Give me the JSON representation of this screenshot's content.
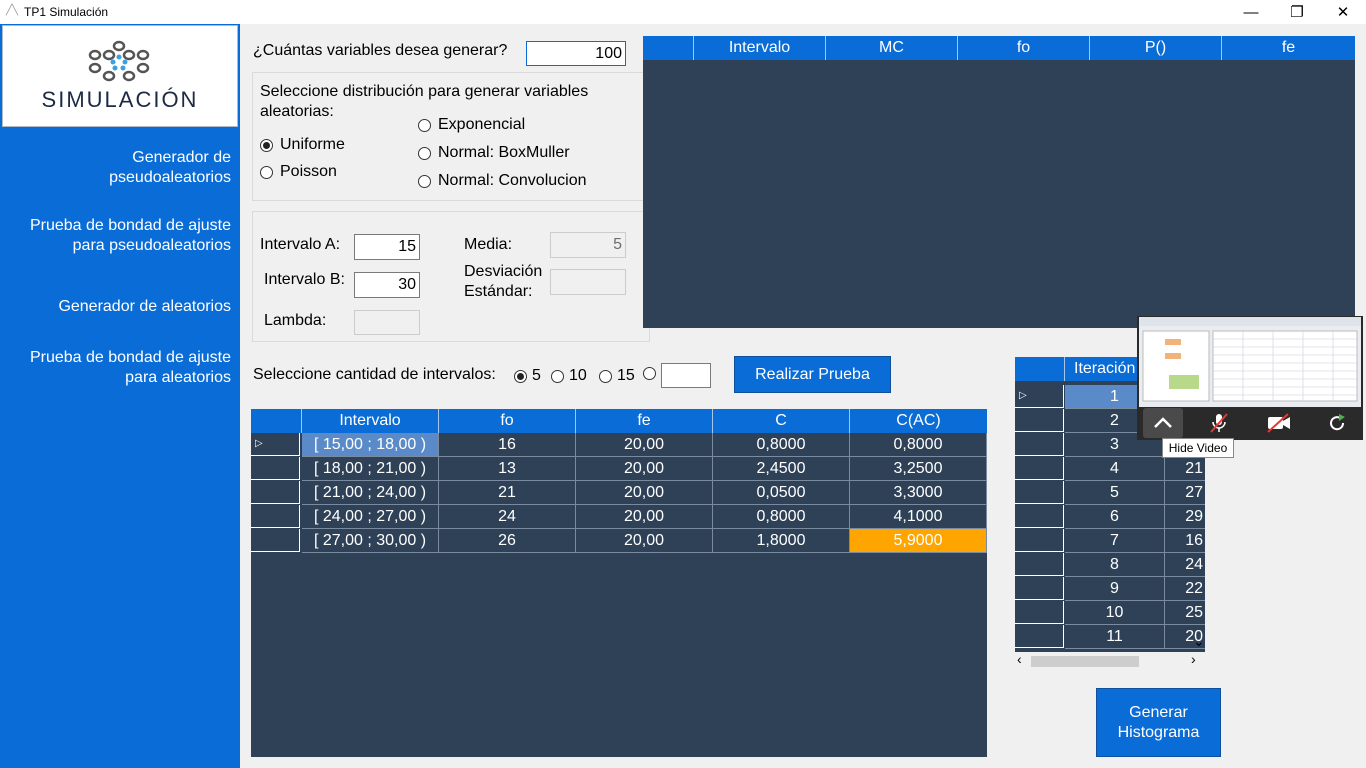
{
  "window": {
    "title": "TP1 Simulación",
    "minimize": "—",
    "restore": "❐",
    "close": "✕"
  },
  "sidebar": {
    "logo_text": "SIMULACIÓN",
    "items": [
      {
        "line1": "Generador de",
        "line2": "pseudoaleatorios"
      },
      {
        "line1": "Prueba de bondad de ajuste",
        "line2": "para pseudoaleatorios"
      },
      {
        "line1": "Generador de aleatorios",
        "line2": ""
      },
      {
        "line1": "Prueba de bondad de ajuste",
        "line2": "para aleatorios"
      }
    ]
  },
  "form": {
    "count_label": "¿Cuántas variables desea generar?",
    "count_value": "100",
    "dist_label": "Seleccione distribución para generar variables aleatorias:",
    "distributions": {
      "uniforme": "Uniforme",
      "poisson": "Poisson",
      "exponencial": "Exponencial",
      "boxmuller": "Normal: BoxMuller",
      "convolucion": "Normal: Convolucion"
    },
    "selected_distribution": "Uniforme",
    "a_label": "Intervalo A:",
    "a_value": "15",
    "b_label": "Intervalo B:",
    "b_value": "30",
    "lambda_label": "Lambda:",
    "lambda_value": "",
    "media_label": "Media:",
    "media_value": "5",
    "desv_label_1": "Desviación",
    "desv_label_2": "Estándar:",
    "desv_value": "",
    "intervals_label": "Seleccione cantidad de intervalos:",
    "interval_options": [
      "5",
      "10",
      "15"
    ],
    "interval_selected": "5",
    "interval_custom": "",
    "test_button": "Realizar Prueba",
    "histogram_button_1": "Generar",
    "histogram_button_2": "Histograma"
  },
  "top_grid": {
    "columns": [
      "Intervalo",
      "MC",
      "fo",
      "P()",
      "fe"
    ]
  },
  "main_grid": {
    "columns": [
      "Intervalo",
      "fo",
      "fe",
      "C",
      "C(AC)"
    ],
    "row_marker": "▷",
    "rows": [
      [
        "[ 15,00 ; 18,00 )",
        "16",
        "20,00",
        "0,8000",
        "0,8000"
      ],
      [
        "[ 18,00 ; 21,00 )",
        "13",
        "20,00",
        "2,4500",
        "3,2500"
      ],
      [
        "[ 21,00 ; 24,00 )",
        "21",
        "20,00",
        "0,0500",
        "3,3000"
      ],
      [
        "[ 24,00 ; 27,00 )",
        "24",
        "20,00",
        "0,8000",
        "4,1000"
      ],
      [
        "[ 27,00 ; 30,00 )",
        "26",
        "20,00",
        "1,8000",
        "5,9000"
      ]
    ]
  },
  "iter_grid": {
    "columns": [
      "Iteración"
    ],
    "rows": [
      [
        "1",
        ""
      ],
      [
        "2",
        ""
      ],
      [
        "3",
        ""
      ],
      [
        "4",
        "21"
      ],
      [
        "5",
        "27"
      ],
      [
        "6",
        "29"
      ],
      [
        "7",
        "16"
      ],
      [
        "8",
        "24"
      ],
      [
        "9",
        "22"
      ],
      [
        "10",
        "25"
      ],
      [
        "11",
        "20"
      ]
    ],
    "scroll_left": "‹",
    "scroll_right": "›",
    "scroll_down": "⌄"
  },
  "video": {
    "tooltip": "Hide Video",
    "controls": [
      "chevron-up-icon",
      "microphone-off-icon",
      "camera-off-icon",
      "share-icon"
    ]
  },
  "colors": {
    "accent": "#0a6cd6",
    "grid_bg": "#2e4157",
    "highlight": "#ffa500"
  }
}
